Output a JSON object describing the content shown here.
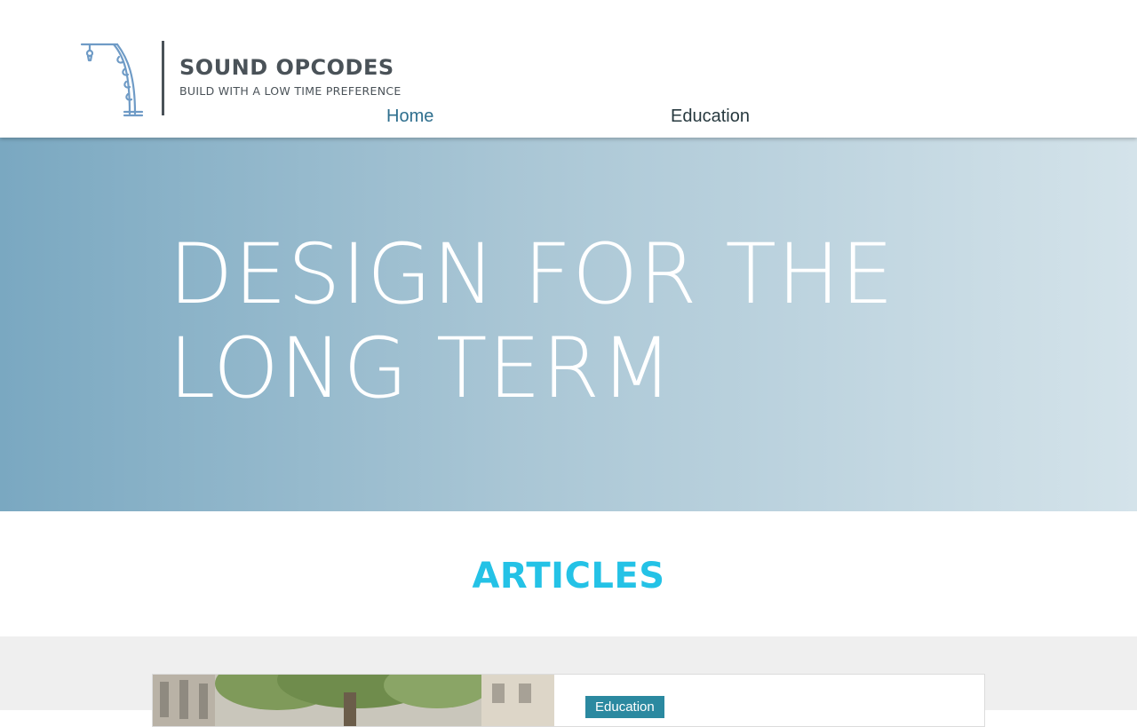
{
  "brand": {
    "name": "SOUND OPCODES",
    "tagline": "BUILD WITH A LOW TIME PREFERENCE"
  },
  "nav": {
    "items": [
      {
        "label": "Home",
        "active": true
      },
      {
        "label": "Education",
        "active": false
      }
    ]
  },
  "hero": {
    "title_line1": "DESIGN FOR THE",
    "title_line2": "LONG TERM"
  },
  "articles": {
    "heading": "ARTICLES",
    "posts": [
      {
        "category": "Education"
      }
    ]
  },
  "colors": {
    "accent": "#24c2e6",
    "nav_active": "#2f6f8e",
    "tag_background": "#2b89a0",
    "brand_text": "#4a5258",
    "logo_mark": "#6f9bc6"
  },
  "icons": {
    "logo_mark": "ornate-lamp-post-icon"
  }
}
